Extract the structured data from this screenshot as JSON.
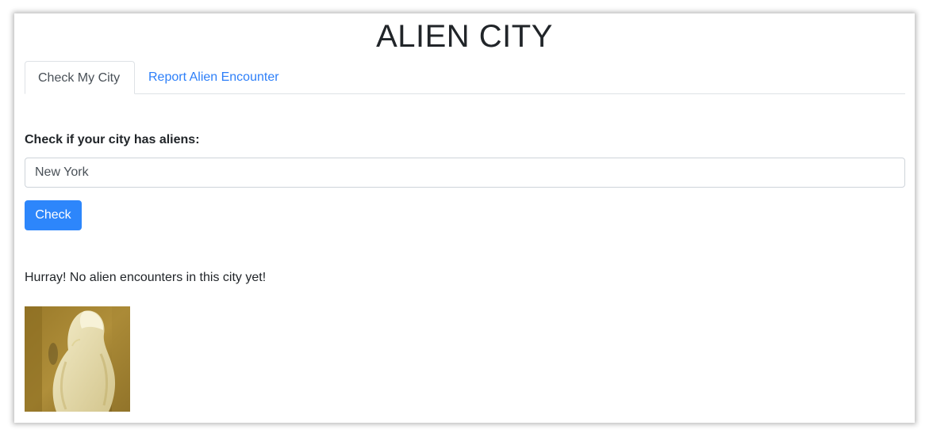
{
  "header": {
    "title": "ALIEN CITY"
  },
  "tabs": [
    {
      "label": "Check My City",
      "active": true
    },
    {
      "label": "Report Alien Encounter",
      "active": false
    }
  ],
  "form": {
    "label": "Check if your city has aliens:",
    "input_value": "New York",
    "button_label": "Check"
  },
  "result": {
    "message": "Hurray! No alien encounters in this city yet!"
  },
  "image": {
    "subject": "white cockatoo parrot"
  },
  "colors": {
    "primary": "#2d86fb",
    "link": "#2d7ff9",
    "text": "#212529"
  }
}
